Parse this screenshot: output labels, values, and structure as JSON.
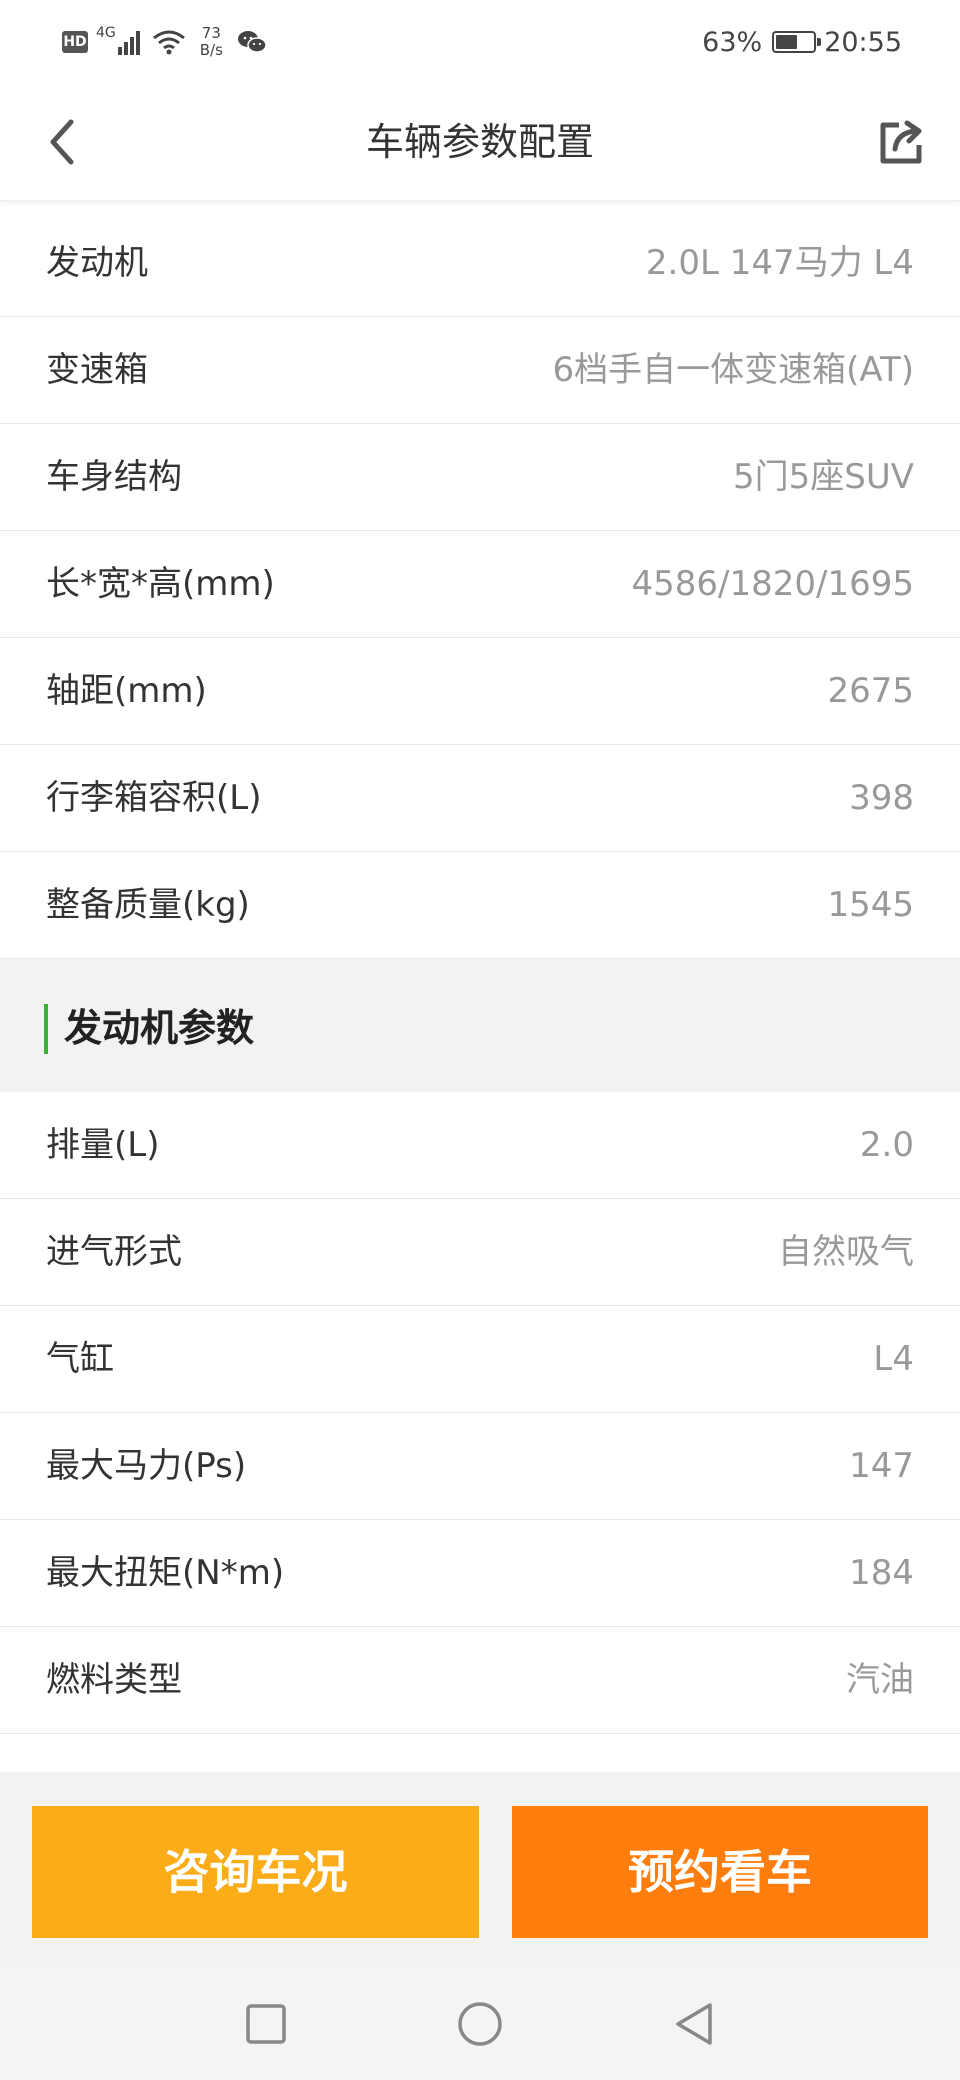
{
  "status_bar": {
    "hd": "HD",
    "network": "4G",
    "speed_value": "73",
    "speed_unit": "B/s",
    "battery_percent": "63%",
    "battery_level": 0.63,
    "time": "20:55",
    "icons": [
      "signal-icon",
      "wifi-icon",
      "wechat-icon",
      "battery-icon"
    ]
  },
  "header": {
    "title": "车辆参数配置",
    "back_icon": "chevron-left-icon",
    "share_icon": "share-icon"
  },
  "basic_params": [
    {
      "label": "发动机",
      "value": "2.0L 147马力 L4"
    },
    {
      "label": "变速箱",
      "value": "6档手自一体变速箱(AT)"
    },
    {
      "label": "车身结构",
      "value": "5门5座SUV"
    },
    {
      "label": "长*宽*高(mm)",
      "value": "4586/1820/1695"
    },
    {
      "label": "轴距(mm)",
      "value": "2675"
    },
    {
      "label": "行李箱容积(L)",
      "value": "398"
    },
    {
      "label": "整备质量(kg)",
      "value": "1545"
    }
  ],
  "engine_section": {
    "title": "发动机参数",
    "accent_color": "#3cb035",
    "params": [
      {
        "label": "排量(L)",
        "value": "2.0"
      },
      {
        "label": "进气形式",
        "value": "自然吸气"
      },
      {
        "label": "气缸",
        "value": "L4"
      },
      {
        "label": "最大马力(Ps)",
        "value": "147"
      },
      {
        "label": "最大扭矩(N*m)",
        "value": "184"
      },
      {
        "label": "燃料类型",
        "value": "汽油"
      }
    ]
  },
  "actions": {
    "consult_label": "咨询车况",
    "consult_color": "#fbac19",
    "book_label": "预约看车",
    "book_color": "#fe7d0d"
  },
  "nav_bar": {
    "icons": [
      "recent-apps-icon",
      "home-icon",
      "back-triangle-icon"
    ]
  }
}
